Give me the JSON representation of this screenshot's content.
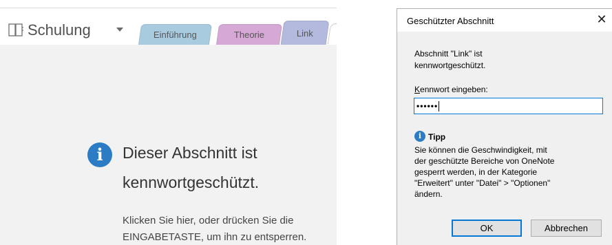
{
  "notebook": {
    "title": "Schulung",
    "tabs": [
      {
        "label": "Einführung",
        "color": "#a9cbe0"
      },
      {
        "label": "Theorie",
        "color": "#d6a8d6"
      },
      {
        "label": "Link",
        "color": "#b4b9de",
        "active": true
      }
    ]
  },
  "locked_page": {
    "message_line1": "Dieser Abschnitt ist",
    "message_line2": "kennwortgeschützt.",
    "hint_line1": "Klicken Sie hier, oder drücken Sie die",
    "hint_line2": "EINGABETASTE, um ihn zu entsperren.",
    "icon": "info-icon",
    "accent": "#2b7cc4"
  },
  "dialog": {
    "title": "Geschützter Abschnitt",
    "close_symbol": "✕",
    "message_line1": "Abschnitt \"Link\" ist",
    "message_line2": "kennwortgeschützt.",
    "password_label_accel": "K",
    "password_label_rest": "ennwort eingeben:",
    "password_value": "••••••",
    "tip_title": "Tipp",
    "tip_lines": [
      "Sie können die Geschwindigkeit, mit",
      "der geschützte Bereiche von OneNote",
      "gesperrt werden, in der Kategorie",
      "\"Erweitert\" unter \"Datei\" > \"Optionen\"",
      "ändern."
    ],
    "ok_label": "OK",
    "cancel_label": "Abbrechen"
  }
}
